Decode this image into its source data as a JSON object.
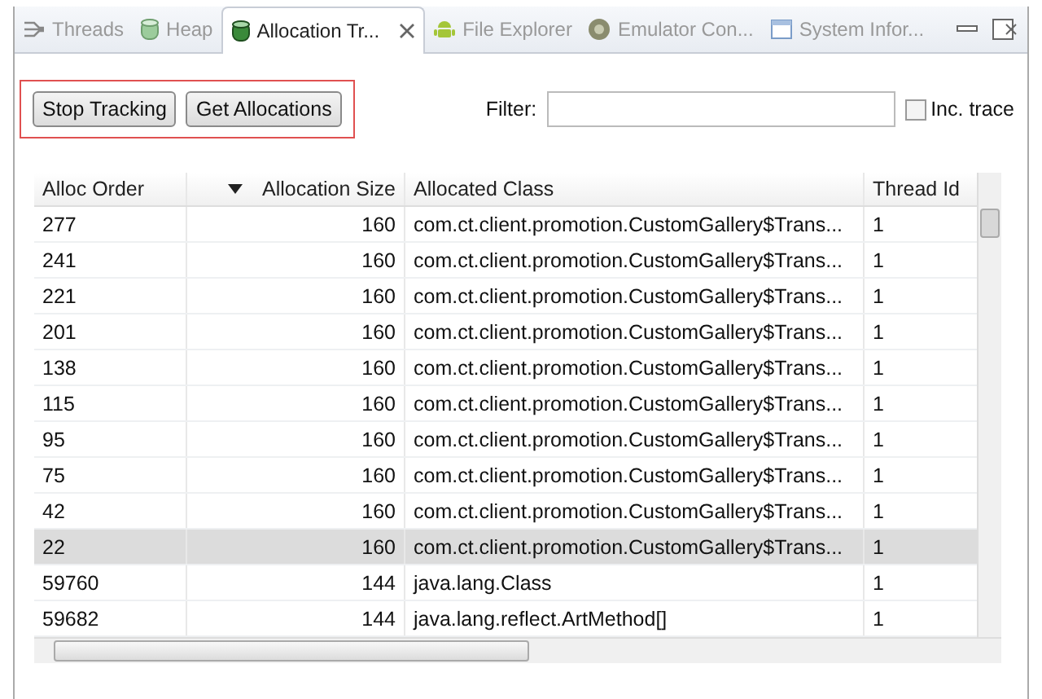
{
  "tabs": [
    {
      "label": "Threads",
      "selected": false
    },
    {
      "label": "Heap",
      "selected": false
    },
    {
      "label": "Allocation Tr...",
      "selected": true
    },
    {
      "label": "File Explorer",
      "selected": false
    },
    {
      "label": "Emulator Con...",
      "selected": false
    },
    {
      "label": "System Infor...",
      "selected": false
    }
  ],
  "buttons": [
    "Stop Tracking",
    "Get Allocations"
  ],
  "filter": {
    "label": "Filter:"
  },
  "inc_trace": {
    "label": "Inc. trace",
    "checked": false
  },
  "table": {
    "columns": [
      "Alloc Order",
      "Allocation Size",
      "Allocated Class",
      "Thread Id"
    ],
    "rows": [
      {
        "cells": [
          "277",
          "160",
          "com.ct.client.promotion.CustomGallery$Trans...",
          "1"
        ],
        "selected": false
      },
      {
        "cells": [
          "241",
          "160",
          "com.ct.client.promotion.CustomGallery$Trans...",
          "1"
        ],
        "selected": false
      },
      {
        "cells": [
          "221",
          "160",
          "com.ct.client.promotion.CustomGallery$Trans...",
          "1"
        ],
        "selected": false
      },
      {
        "cells": [
          "201",
          "160",
          "com.ct.client.promotion.CustomGallery$Trans...",
          "1"
        ],
        "selected": false
      },
      {
        "cells": [
          "138",
          "160",
          "com.ct.client.promotion.CustomGallery$Trans...",
          "1"
        ],
        "selected": false
      },
      {
        "cells": [
          "115",
          "160",
          "com.ct.client.promotion.CustomGallery$Trans...",
          "1"
        ],
        "selected": false
      },
      {
        "cells": [
          "95",
          "160",
          "com.ct.client.promotion.CustomGallery$Trans...",
          "1"
        ],
        "selected": false
      },
      {
        "cells": [
          "75",
          "160",
          "com.ct.client.promotion.CustomGallery$Trans...",
          "1"
        ],
        "selected": false
      },
      {
        "cells": [
          "42",
          "160",
          "com.ct.client.promotion.CustomGallery$Trans...",
          "1"
        ],
        "selected": false
      },
      {
        "cells": [
          "22",
          "160",
          "com.ct.client.promotion.CustomGallery$Trans...",
          "1"
        ],
        "selected": true
      },
      {
        "cells": [
          "59760",
          "144",
          "java.lang.Class",
          "1"
        ],
        "selected": false
      },
      {
        "cells": [
          "59682",
          "144",
          "java.lang.reflect.ArtMethod[]",
          "1"
        ],
        "selected": false
      }
    ]
  }
}
